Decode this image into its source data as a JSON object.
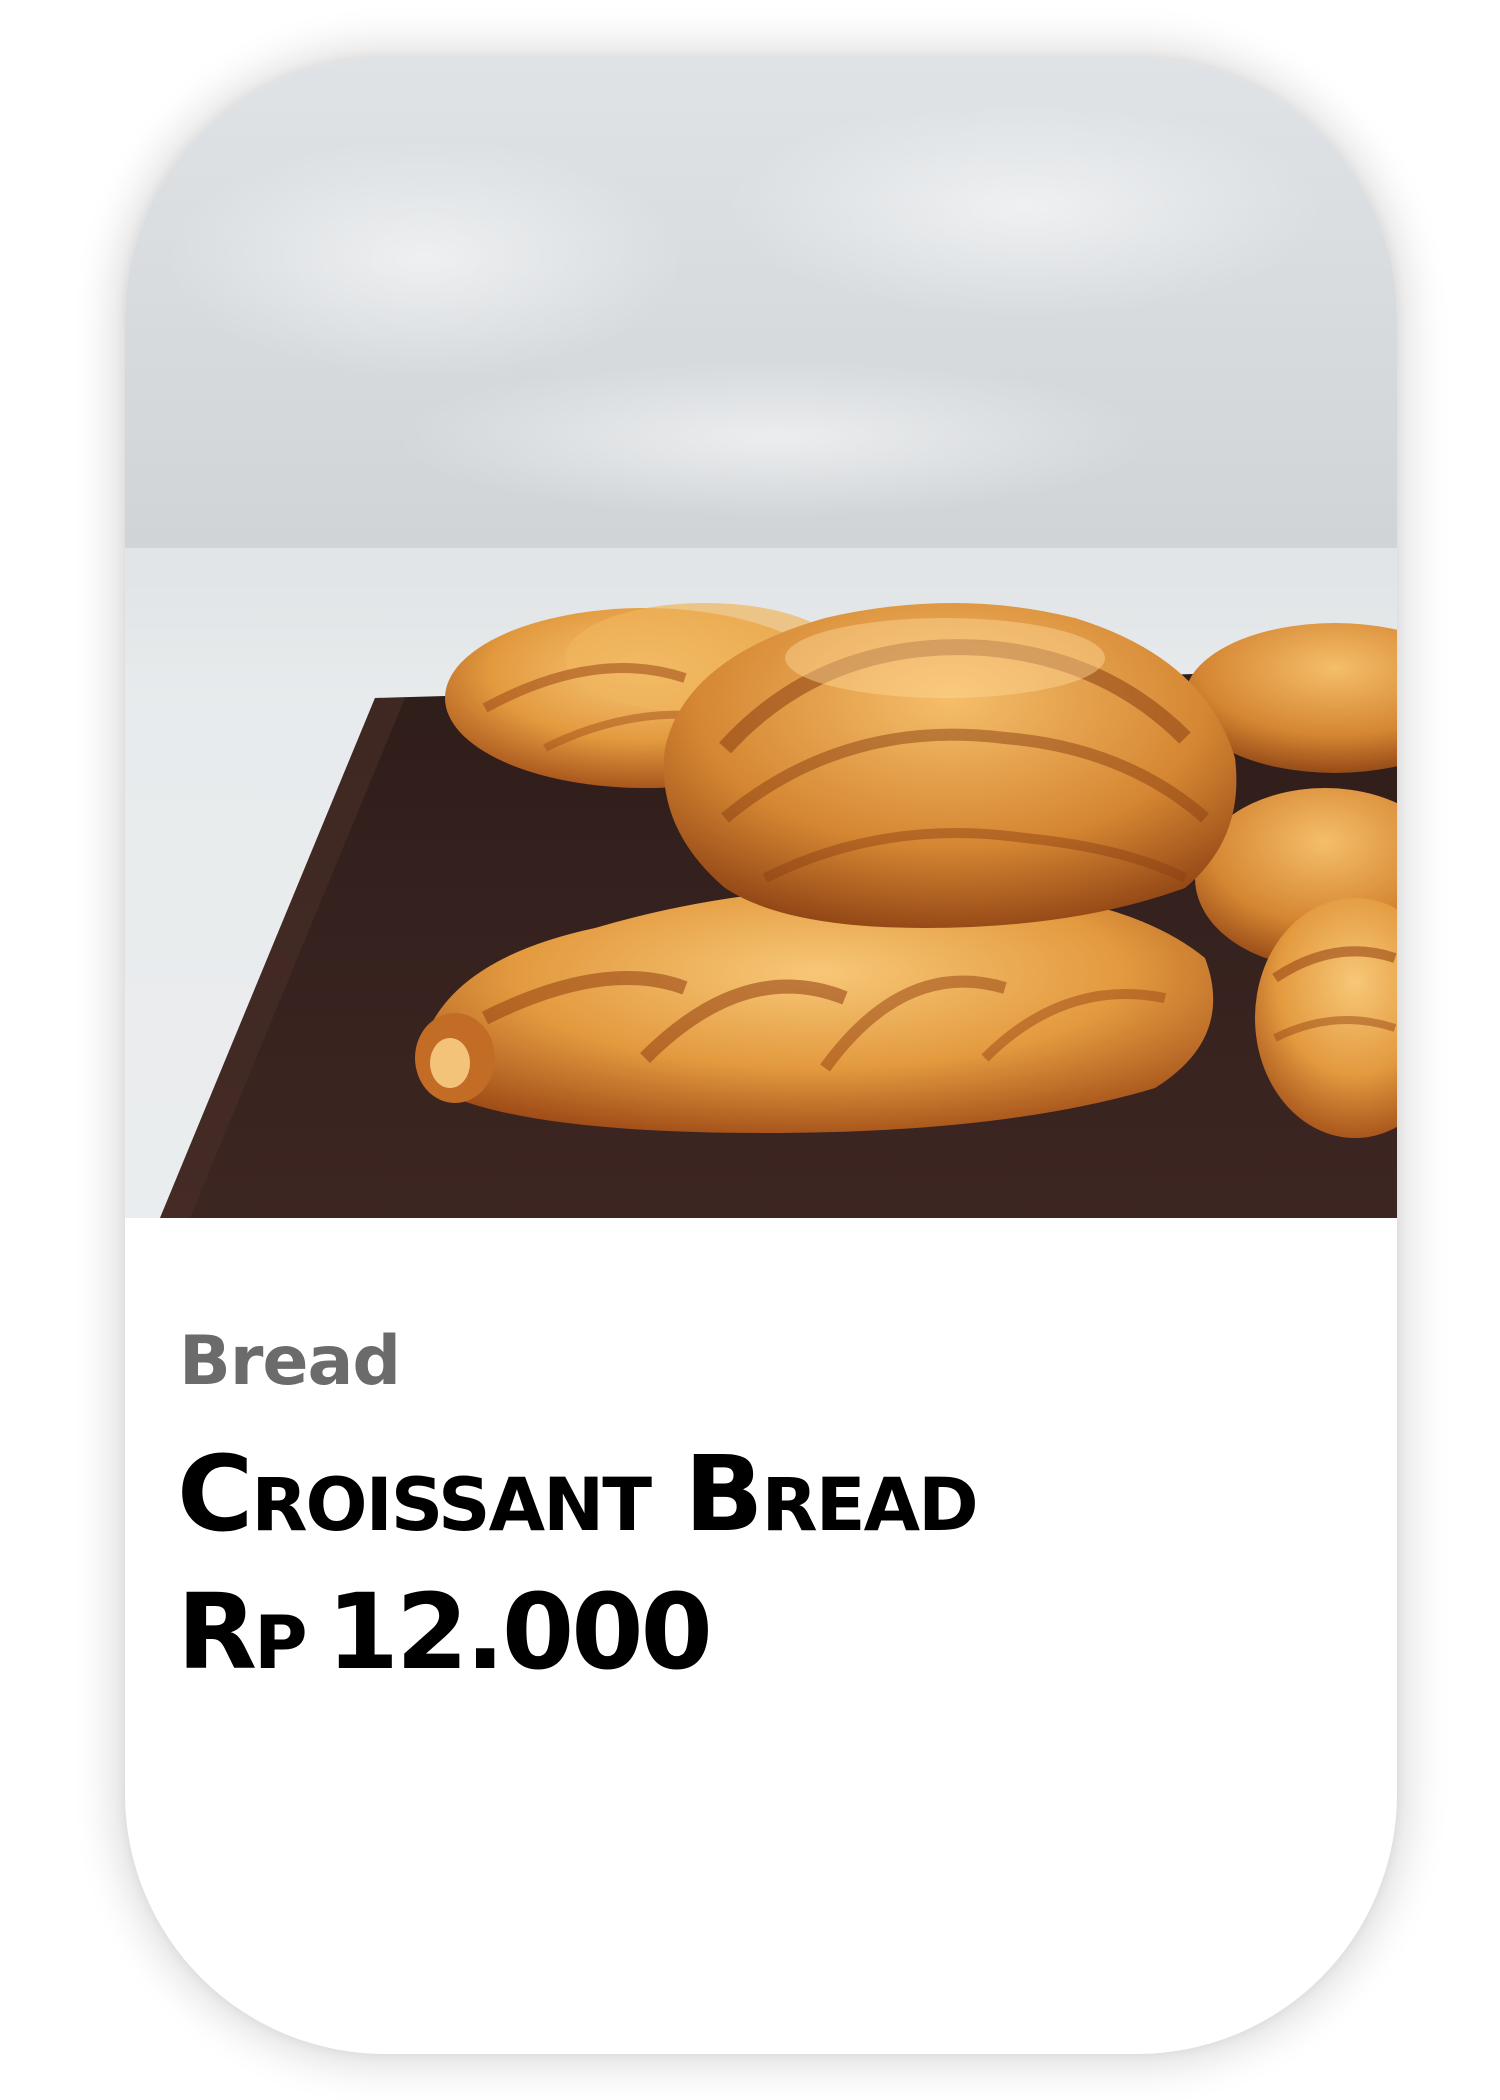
{
  "product_card": {
    "image": {
      "alt": "croissant-bread-photo",
      "colors": {
        "background_top": "#d9dde0",
        "background_bottom": "#e8ebed",
        "board": "#3a2420",
        "pastry_light": "#f2b45a",
        "pastry_dark": "#a9531c"
      }
    },
    "category": "Bread",
    "name": "Croissant Bread",
    "price": {
      "currency": "Rp",
      "amount": "12.000"
    }
  }
}
